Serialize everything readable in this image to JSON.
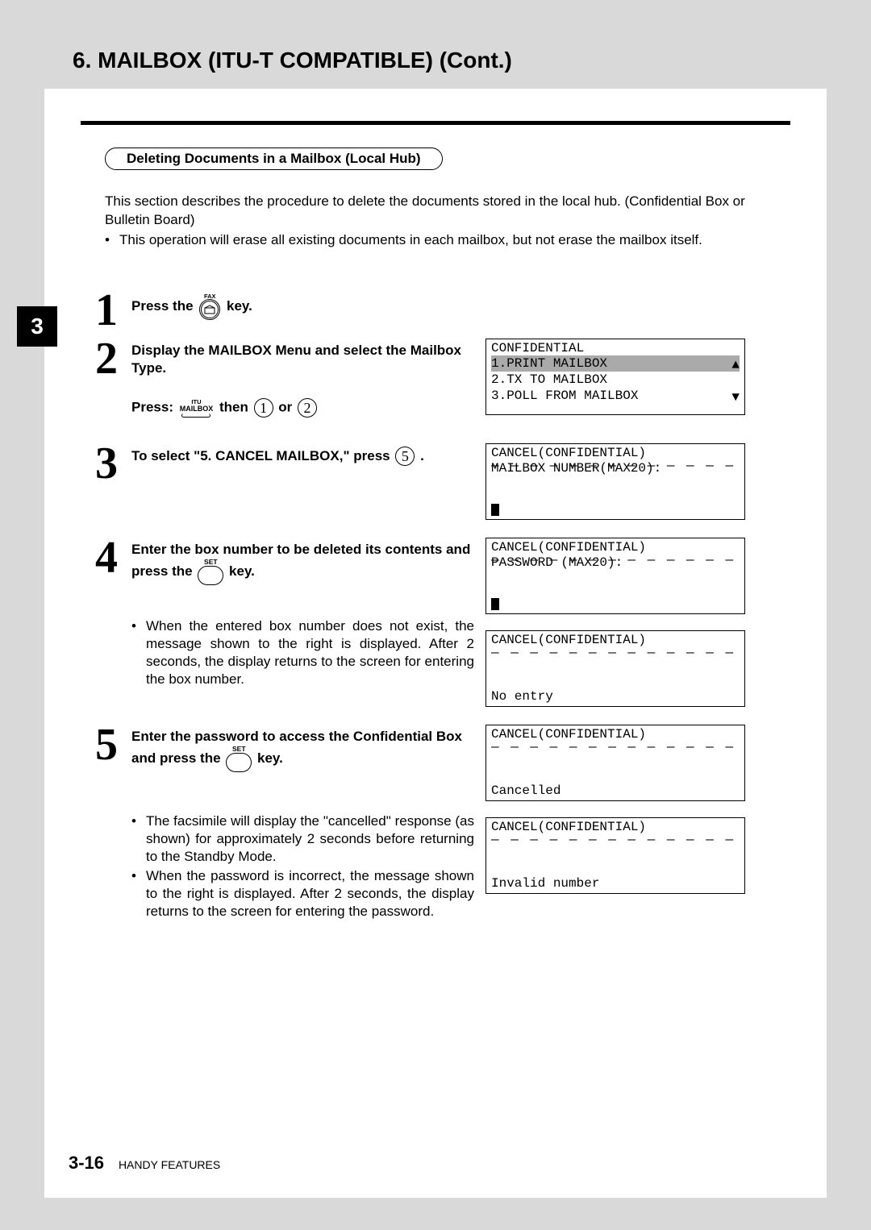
{
  "chapter_tab": "3",
  "chapter_title": "6. MAILBOX (ITU-T COMPATIBLE) (Cont.)",
  "subheading": "Deleting Documents in a Mailbox (Local Hub)",
  "intro_text": "This section describes the procedure to delete the documents stored in the local hub. (Confidential Box or Bulletin Board)",
  "intro_bullet": "This operation will erase all existing documents in each mailbox, but not erase the mailbox itself.",
  "steps": {
    "s1": {
      "num": "1",
      "text_a": "Press the ",
      "text_b": " key.",
      "fax_label": "FAX"
    },
    "s2": {
      "num": "2",
      "main": "Display the MAILBOX Menu and select the Mailbox Type.",
      "press_a": "Press: ",
      "itu": "ITU",
      "mailbox": "MAILBOX",
      "then": " then ",
      "key1": "1",
      "or": " or ",
      "key2": "2"
    },
    "s3": {
      "num": "3",
      "text_a": "To select \"5. CANCEL MAILBOX,\" press ",
      "key": "5",
      "text_b": " ."
    },
    "s4": {
      "num": "4",
      "text_a": "Enter the box number to be deleted its contents and press the ",
      "set": "SET",
      "text_b": " key.",
      "bullet": "When the entered box number does not exist, the message shown to the right is displayed.  After 2 seconds, the display returns to the screen for entering the box number."
    },
    "s5": {
      "num": "5",
      "text_a": "Enter the password to access the Confidential Box and press the ",
      "set": "SET",
      "text_b": " key.",
      "bullet1": "The facsimile will display the \"cancelled\" response (as shown) for approximately 2 seconds before returning to the Standby Mode.",
      "bullet2": "When the password is incorrect, the message shown to the right is displayed. After 2 seconds, the display returns to the screen for entering the password."
    }
  },
  "lcd": {
    "menu": {
      "l1": "CONFIDENTIAL",
      "l2": "1.PRINT MAILBOX",
      "l3": "2.TX TO MAILBOX",
      "l4": "3.POLL FROM MAILBOX",
      "up": "▲",
      "down": "▼"
    },
    "cancel_num": {
      "l1": "CANCEL(CONFIDENTIAL)",
      "l2": "MAILBOX NUMBER(MAX20):"
    },
    "cancel_pw": {
      "l1": "CANCEL(CONFIDENTIAL)",
      "l2": "PASSWORD (MAX20):"
    },
    "noentry": {
      "l1": "CANCEL(CONFIDENTIAL)",
      "bottom": "No entry"
    },
    "cancelled": {
      "l1": "CANCEL(CONFIDENTIAL)",
      "bottom": "Cancelled"
    },
    "invalid": {
      "l1": "CANCEL(CONFIDENTIAL)",
      "bottom": "Invalid number"
    }
  },
  "dashes": "— — — — — — — — — — — — —",
  "footer": {
    "page": "3-16",
    "label": "HANDY FEATURES"
  }
}
